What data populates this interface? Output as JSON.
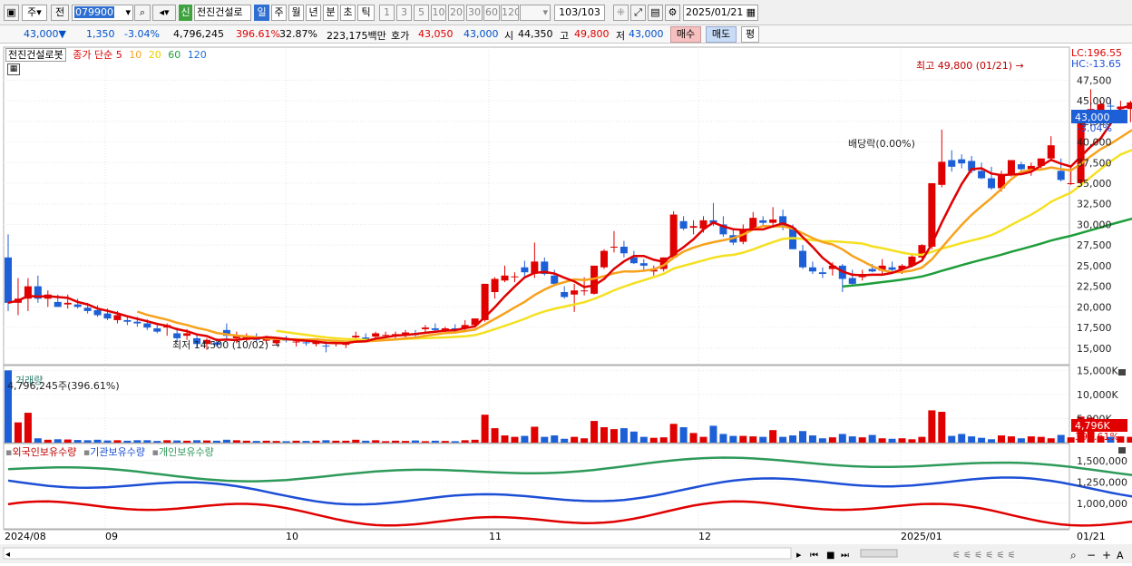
{
  "toolbar": {
    "mode_label": "주",
    "prev_label": "전",
    "code_value": "079900",
    "stock_name": "전진건설로",
    "new_badge": "신",
    "periods": [
      "일",
      "주",
      "월",
      "년",
      "분",
      "초",
      "틱"
    ],
    "selected_period": "일",
    "minutes": [
      "1",
      "3",
      "5",
      "10",
      "20",
      "30",
      "60",
      "120"
    ],
    "page_indicator": "103/103",
    "date_value": "2025/01/21"
  },
  "info": {
    "price": "43,000▼",
    "change": "1,350",
    "change_pct": "-3.04%",
    "volume": "4,796,245",
    "volume_ratio": "396.61%",
    "turnover_ratio": "32.87%",
    "trade_amount": "223,175백만",
    "quote_label": "호가",
    "ask": "43,050",
    "bid": "43,000",
    "open_label": "시",
    "open": "44,350",
    "high_label": "고",
    "high": "49,800",
    "low_label": "저",
    "low": "43,000",
    "buy_label": "매수",
    "sell_label": "매도",
    "avg_label": "평"
  },
  "price_panel": {
    "name_tab": "전진건설로봇",
    "ma_title": "종가 단순",
    "ma_periods": [
      "5",
      "10",
      "20",
      "60",
      "120"
    ],
    "ma_colors": [
      "#e00000",
      "#f7a21c",
      "#f5e020",
      "#1e9e3a",
      "#1d6fd6"
    ],
    "lc_label": "LC:196.55",
    "hc_label": "HC:-13.65",
    "high_annotation": "최고 49,800 (01/21) →",
    "low_annotation": "최저 14,500 (10/02) →",
    "dividend_annotation": "배당락(0.00%)",
    "current_price_tag": "43,000",
    "current_change_tag": "-3.04%",
    "y_labels": [
      "47,500",
      "45,000",
      "42,500",
      "40,000",
      "37,500",
      "35,000",
      "32,500",
      "30,000",
      "27,500",
      "25,000",
      "22,500",
      "20,000",
      "17,500",
      "15,000"
    ]
  },
  "volume_panel": {
    "title": "거래량",
    "summary": "4,796,245주(396.61%)",
    "y_labels": [
      "15,000K",
      "10,000K",
      "5,000K"
    ],
    "current_tag": "4,796K",
    "current_pct_tag": "396.61%"
  },
  "holdings_panel": {
    "series_labels": [
      "외국인보유수량",
      "기관보유수량",
      "개인보유수량"
    ],
    "series_colors": [
      "#e00000",
      "#1d4fd6",
      "#2e9a5a"
    ],
    "y_labels": [
      "1,500,000",
      "1,250,000",
      "1,000,000"
    ]
  },
  "x_axis": {
    "labels": [
      "2024/08",
      "09",
      "10",
      "11",
      "12",
      "2025/01"
    ],
    "current_label": "01/21"
  },
  "chart_data": {
    "type": "candlestick",
    "ohlc": [
      [
        26000,
        28800,
        19500,
        20500
      ],
      [
        20500,
        23500,
        19000,
        21000
      ],
      [
        21000,
        23500,
        19500,
        22500
      ],
      [
        22500,
        23800,
        20500,
        21000
      ],
      [
        21000,
        22000,
        20000,
        21500
      ],
      [
        20600,
        21500,
        20000,
        20000
      ],
      [
        20300,
        21500,
        19800,
        20500
      ],
      [
        20300,
        21000,
        19800,
        20000
      ],
      [
        19900,
        20500,
        19200,
        19500
      ],
      [
        19600,
        20200,
        18800,
        19000
      ],
      [
        19200,
        19800,
        18400,
        18600
      ],
      [
        18400,
        19500,
        18000,
        19000
      ],
      [
        18400,
        19000,
        17800,
        18200
      ],
      [
        18200,
        18800,
        17600,
        18000
      ],
      [
        18000,
        18500,
        17200,
        17500
      ],
      [
        17400,
        18000,
        16800,
        17000
      ],
      [
        17500,
        18000,
        16500,
        17800
      ],
      [
        16800,
        17500,
        15800,
        16200
      ],
      [
        16500,
        17300,
        16000,
        16800
      ],
      [
        16200,
        16800,
        15000,
        15500
      ],
      [
        15500,
        16200,
        14800,
        16000
      ],
      [
        15700,
        16200,
        15200,
        15400
      ],
      [
        17200,
        18000,
        16000,
        16500
      ],
      [
        16200,
        17000,
        15600,
        16500
      ],
      [
        16000,
        16800,
        15800,
        16500
      ],
      [
        16200,
        16800,
        15800,
        16000
      ],
      [
        15900,
        16500,
        15500,
        16200
      ],
      [
        15600,
        16300,
        15400,
        16000
      ],
      [
        16100,
        16500,
        15700,
        15900
      ],
      [
        15700,
        16200,
        15200,
        15800
      ],
      [
        15700,
        16000,
        15300,
        15600
      ],
      [
        15500,
        16000,
        15200,
        15700
      ],
      [
        15300,
        15900,
        14500,
        15200
      ],
      [
        15600,
        16000,
        15200,
        15800
      ],
      [
        15400,
        15800,
        15000,
        15700
      ],
      [
        16300,
        17000,
        16000,
        16500
      ],
      [
        16300,
        16800,
        15800,
        16000
      ],
      [
        16400,
        17000,
        16000,
        16800
      ],
      [
        16500,
        17000,
        16200,
        16600
      ],
      [
        16600,
        17000,
        16200,
        16700
      ],
      [
        16700,
        17200,
        16300,
        16900
      ],
      [
        16800,
        17200,
        16300,
        16600
      ],
      [
        17300,
        17800,
        16900,
        17500
      ],
      [
        17400,
        18000,
        17000,
        17200
      ],
      [
        17100,
        17600,
        16800,
        17400
      ],
      [
        17400,
        17900,
        17000,
        17200
      ],
      [
        17400,
        18400,
        17100,
        17800
      ],
      [
        17800,
        18600,
        17500,
        18600
      ],
      [
        18400,
        22800,
        18200,
        22800
      ],
      [
        21800,
        23600,
        21000,
        23400
      ],
      [
        23200,
        25000,
        23000,
        23800
      ],
      [
        23600,
        24200,
        23000,
        23700
      ],
      [
        24800,
        25600,
        23600,
        24200
      ],
      [
        24100,
        27800,
        23500,
        25500
      ],
      [
        25500,
        26000,
        23800,
        24000
      ],
      [
        23800,
        24500,
        22500,
        22800
      ],
      [
        21800,
        22500,
        21000,
        21200
      ],
      [
        21500,
        22800,
        19400,
        22000
      ],
      [
        22000,
        23600,
        21400,
        22000
      ],
      [
        21600,
        25000,
        21500,
        25000
      ],
      [
        24800,
        27000,
        24600,
        26800
      ],
      [
        27200,
        29200,
        26600,
        27300
      ],
      [
        27300,
        28000,
        26000,
        26500
      ],
      [
        26000,
        26800,
        25200,
        25300
      ],
      [
        25300,
        25800,
        24500,
        25000
      ],
      [
        24300,
        25000,
        23800,
        24500
      ],
      [
        24600,
        26000,
        24300,
        26000
      ],
      [
        26000,
        31600,
        25800,
        31200
      ],
      [
        30400,
        31000,
        29300,
        29500
      ],
      [
        29600,
        30500,
        28800,
        29800
      ],
      [
        29500,
        31000,
        29000,
        30500
      ],
      [
        30500,
        32600,
        29800,
        30200
      ],
      [
        30000,
        31000,
        28500,
        28800
      ],
      [
        28700,
        29500,
        27500,
        27800
      ],
      [
        27900,
        30000,
        27600,
        29400
      ],
      [
        29400,
        31500,
        29300,
        30800
      ],
      [
        30500,
        31000,
        29800,
        30200
      ],
      [
        30200,
        32100,
        29600,
        30600
      ],
      [
        31000,
        31800,
        29300,
        29700
      ],
      [
        29600,
        30000,
        27000,
        27000
      ],
      [
        26800,
        27500,
        24600,
        24800
      ],
      [
        24800,
        25500,
        24000,
        24300
      ],
      [
        24200,
        24800,
        23500,
        24000
      ],
      [
        24600,
        25400,
        23800,
        25000
      ],
      [
        25000,
        25200,
        21800,
        23400
      ],
      [
        23500,
        24500,
        22500,
        22800
      ],
      [
        23600,
        24500,
        23200,
        24000
      ],
      [
        24600,
        25200,
        24200,
        24300
      ],
      [
        24400,
        25800,
        24000,
        25000
      ],
      [
        24800,
        25500,
        24200,
        24500
      ],
      [
        24600,
        25200,
        24000,
        25000
      ],
      [
        25000,
        26500,
        24800,
        26100
      ],
      [
        26000,
        27600,
        25900,
        27500
      ],
      [
        27300,
        35000,
        27000,
        35000
      ],
      [
        34800,
        41500,
        34500,
        37600
      ],
      [
        37800,
        39000,
        36400,
        37000
      ],
      [
        37900,
        38500,
        36800,
        37400
      ],
      [
        37700,
        38300,
        36200,
        36500
      ],
      [
        36500,
        37500,
        35500,
        35600
      ],
      [
        35600,
        37000,
        34200,
        34400
      ],
      [
        34400,
        36500,
        34000,
        36000
      ],
      [
        36100,
        37800,
        35800,
        37800
      ],
      [
        37300,
        37600,
        36000,
        36700
      ],
      [
        36700,
        37500,
        35900,
        37100
      ],
      [
        37100,
        38000,
        36800,
        38000
      ],
      [
        38000,
        40700,
        37800,
        39600
      ],
      [
        36500,
        38000,
        35200,
        35400
      ],
      [
        35000,
        37000,
        34800,
        35000
      ],
      [
        35000,
        43200,
        34800,
        43200
      ],
      [
        43200,
        46400,
        42800,
        44000
      ],
      [
        43800,
        45000,
        43200,
        44600
      ],
      [
        44400,
        45200,
        42700,
        44300
      ],
      [
        44000,
        45000,
        43000,
        44300
      ],
      [
        44000,
        45000,
        42400,
        44800
      ],
      [
        44400,
        45300,
        43500,
        44200
      ],
      [
        44800,
        45600,
        44000,
        44300
      ],
      [
        44350,
        49800,
        43000,
        43000
      ]
    ],
    "volume_thousands": [
      15000,
      4200,
      6200,
      900,
      600,
      700,
      650,
      550,
      500,
      600,
      450,
      500,
      400,
      500,
      500,
      350,
      500,
      450,
      400,
      500,
      450,
      400,
      600,
      500,
      400,
      350,
      400,
      350,
      300,
      400,
      350,
      400,
      500,
      400,
      400,
      600,
      400,
      500,
      300,
      400,
      350,
      450,
      300,
      400,
      350,
      300,
      500,
      600,
      5800,
      3000,
      1500,
      1200,
      1400,
      3300,
      1200,
      1500,
      800,
      1200,
      900,
      4500,
      3200,
      2800,
      3000,
      2300,
      1200,
      1000,
      1100,
      3900,
      3200,
      2000,
      1200,
      3500,
      1800,
      1400,
      1400,
      1300,
      1200,
      2600,
      1200,
      1500,
      2400,
      1500,
      900,
      1100,
      1800,
      1300,
      1100,
      1600,
      900,
      800,
      900,
      700,
      1200,
      6700,
      6400,
      1400,
      1800,
      1300,
      1000,
      700,
      1500,
      1300,
      900,
      1300,
      1200,
      900,
      1600,
      1100,
      5400,
      5200,
      1300,
      1200,
      1300,
      1200,
      1200,
      1300,
      4796
    ],
    "ma_starts": {
      "ma5": 0,
      "ma10": 13,
      "ma20": 27,
      "ma60": 84
    },
    "y_range": [
      13000,
      51500
    ],
    "volume_range": [
      0,
      16000
    ],
    "holdings_range": [
      700000,
      1700000
    ]
  }
}
